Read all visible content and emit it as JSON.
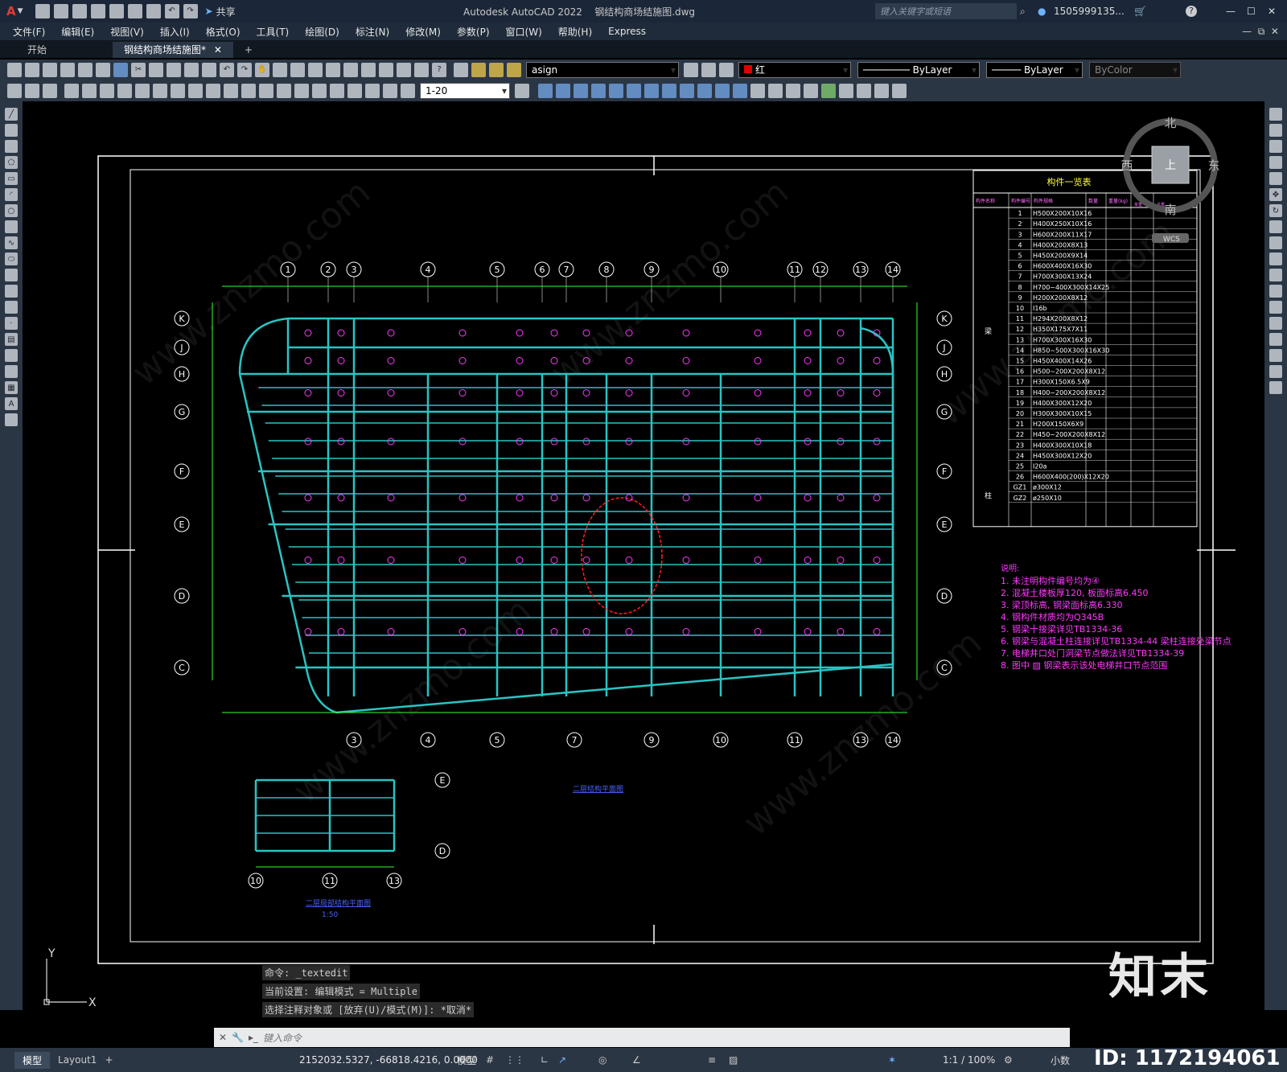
{
  "titlebar": {
    "app": "Autodesk AutoCAD 2022",
    "file": "钢结构商场结施图.dwg",
    "search_placeholder": "键入关键字或短语",
    "user": "1505999135...",
    "share": "共享"
  },
  "menu": [
    "文件(F)",
    "编辑(E)",
    "视图(V)",
    "插入(I)",
    "格式(O)",
    "工具(T)",
    "绘图(D)",
    "标注(N)",
    "修改(M)",
    "参数(P)",
    "窗口(W)",
    "帮助(H)",
    "Express"
  ],
  "tabs": {
    "start": "开始",
    "drawing": "钢结构商场结施图*",
    "add": "+"
  },
  "toolbar": {
    "layer": "asign",
    "color": "红",
    "linetype": "ByLayer",
    "lineweight": "ByLayer",
    "plotstyle": "ByColor",
    "scale": "1-20"
  },
  "viewcube": {
    "north": "北",
    "south": "南",
    "east": "东",
    "west": "西",
    "top": "上",
    "wcs": "WCS"
  },
  "table": {
    "title": "构件一览表",
    "headers": [
      "构件名称",
      "构件编号",
      "构件规格",
      "数量",
      "重量(kg)"
    ],
    "sub": [
      "单重",
      "总重"
    ],
    "group_beam": "梁",
    "group_col": "柱",
    "rows": [
      [
        "1",
        "H500X200X10X16"
      ],
      [
        "2",
        "H400X250X10X16"
      ],
      [
        "3",
        "H600X200X11X17"
      ],
      [
        "4",
        "H400X200X8X13"
      ],
      [
        "5",
        "H450X200X9X14"
      ],
      [
        "6",
        "H600X400X16X30"
      ],
      [
        "7",
        "H700X300X13X24"
      ],
      [
        "8",
        "H700~400X300X14X25"
      ],
      [
        "9",
        "H200X200X8X12"
      ],
      [
        "10",
        "I16b"
      ],
      [
        "11",
        "H294X200X8X12"
      ],
      [
        "12",
        "H350X175X7X11"
      ],
      [
        "13",
        "H700X300X16X30"
      ],
      [
        "14",
        "H850~500X300X16X30"
      ],
      [
        "15",
        "H450X400X14X26"
      ],
      [
        "16",
        "H500~200X200X8X12"
      ],
      [
        "17",
        "H300X150X6.5X9"
      ],
      [
        "18",
        "H400~200X200X8X12"
      ],
      [
        "19",
        "H400X300X12X20"
      ],
      [
        "20",
        "H300X300X10X15"
      ],
      [
        "21",
        "H200X150X6X9"
      ],
      [
        "22",
        "H450~200X200X8X12"
      ],
      [
        "23",
        "H400X300X10X18"
      ],
      [
        "24",
        "H450X300X12X20"
      ],
      [
        "25",
        "I20a"
      ],
      [
        "26",
        "H600X400(200)X12X20"
      ],
      [
        "GZ1",
        "ø300X12"
      ],
      [
        "GZ2",
        "ø250X10"
      ]
    ]
  },
  "notes": {
    "title": "说明:",
    "items": [
      "1. 未注明构件编号均为④",
      "2. 混凝土楼板厚120, 板面标高6.450",
      "3. 梁顶标高, 钢梁面标高6.330",
      "4. 钢构件材质均为Q345B",
      "5. 钢梁十接梁详见TB1334-36",
      "6. 钢梁与混凝土柱连接详见TB1334-44 梁柱连接处梁节点",
      "7. 电梯井口处门洞梁节点做法详见TB1334-39",
      "8. 图中 ▨ 钢梁表示该处电梯井口节点范围"
    ]
  },
  "grid": {
    "top": [
      "1",
      "2",
      "3",
      "4",
      "5",
      "6",
      "7",
      "8",
      "9",
      "10",
      "11",
      "12",
      "13",
      "14"
    ],
    "bottom": [
      "3",
      "4",
      "5",
      "7",
      "9",
      "10",
      "11",
      "13",
      "14"
    ],
    "rows": [
      "K",
      "J",
      "H",
      "G",
      "F",
      "E",
      "D",
      "C"
    ],
    "detail_cols": [
      "10",
      "11",
      "13"
    ],
    "detail_rows": [
      "E",
      "D"
    ]
  },
  "labels": {
    "plan": "二层结构平面图",
    "detail": "二层局部结构平面图",
    "detail_scale": "1:50"
  },
  "ucs": {
    "x": "X",
    "y": "Y"
  },
  "command": {
    "history": [
      "命令: _textedit",
      "当前设置: 编辑模式 = Multiple",
      "选择注释对象或 [放弃(U)/模式(M)]: *取消*"
    ],
    "placeholder": "键入命令"
  },
  "status": {
    "layout_model": "模型",
    "layout1": "Layout1",
    "coords": "2152032.5327, -66818.4216, 0.0000",
    "space": "模型",
    "scale": "1:1 / 100%",
    "units": "小数"
  },
  "watermark": {
    "brand": "知末",
    "id": "ID: 1172194061",
    "site": "www.znzmo.com"
  },
  "colors": {
    "beam": "#29c4c4",
    "label": "#ff38ff",
    "dim": "#33ff33",
    "grid": "#ffffff",
    "revision": "#ff2020"
  }
}
